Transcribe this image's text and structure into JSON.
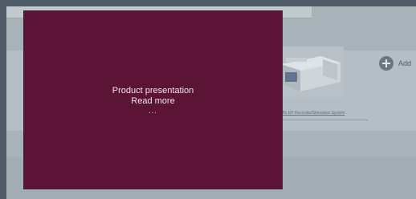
{
  "overlay": {
    "title": "Product presentation",
    "read_more": "Read more",
    "ellipsis": "..."
  },
  "product": {
    "caption": "EMG EP Recorder/Stimulator System",
    "image": "emg-device-image"
  },
  "actions": {
    "add_label": "Add",
    "add_icon": "plus-circle-icon"
  },
  "colors": {
    "overlay_bg": "#5c1436",
    "dim_backdrop": "#4e5b66"
  }
}
